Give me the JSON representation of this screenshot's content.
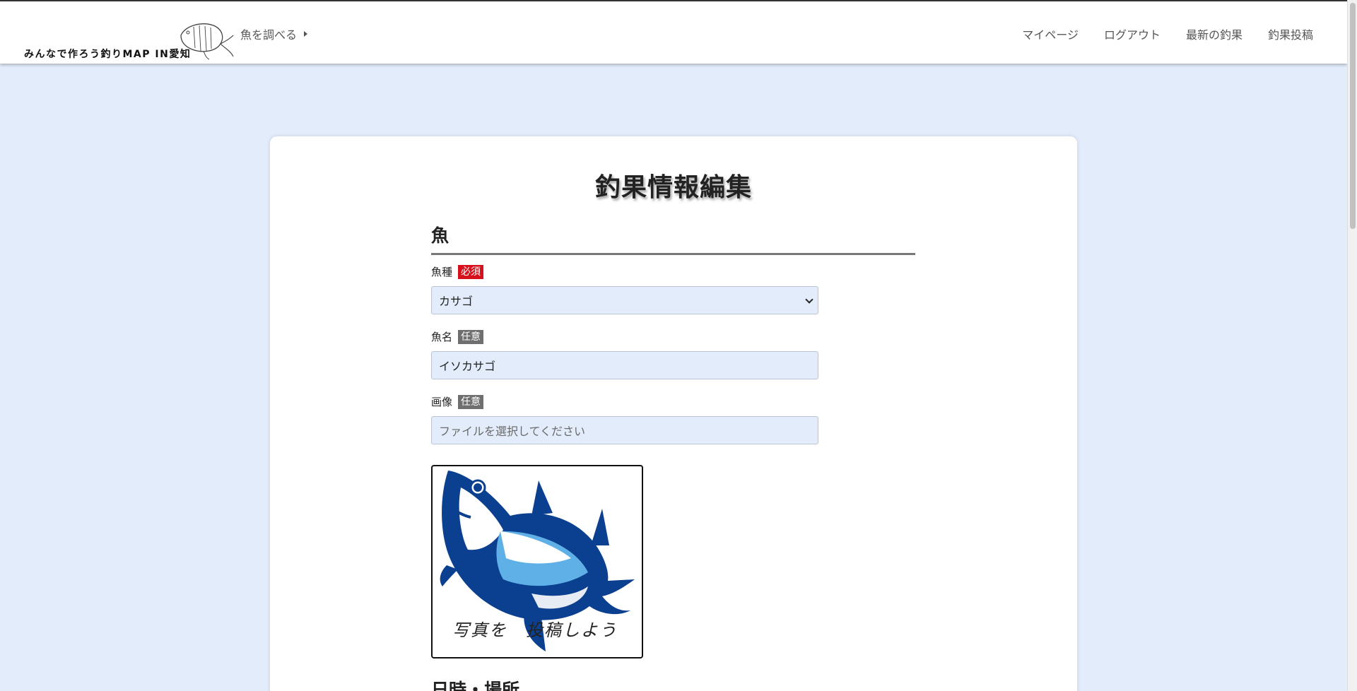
{
  "header": {
    "logo_text": "みんなで作ろう釣りMAP IN愛知",
    "nav_fish_label": "魚を調べる",
    "nav_items": [
      "マイページ",
      "ログアウト",
      "最新の釣果",
      "釣果投稿"
    ]
  },
  "page": {
    "title": "釣果情報編集"
  },
  "form": {
    "section_fish": "魚",
    "fish_type": {
      "label": "魚種",
      "badge": "必須",
      "selected": "カサゴ"
    },
    "fish_name": {
      "label": "魚名",
      "badge": "任意",
      "value": "イソカサゴ"
    },
    "image": {
      "label": "画像",
      "badge": "任意",
      "placeholder": "ファイルを選択してください",
      "preview_caption": "写真を　投稿しよう"
    },
    "section_datetime": "日時・場所"
  },
  "colors": {
    "background": "#e3ecfb",
    "required_badge": "#d7111b",
    "optional_badge": "#6f6f6f",
    "fish_blue": "#0b3f8f",
    "fish_light": "#5fb0e6"
  }
}
